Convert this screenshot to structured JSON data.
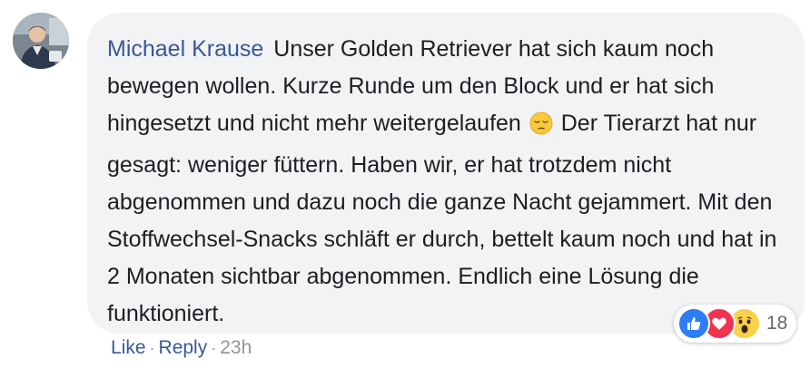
{
  "comment": {
    "author": "Michael Krause",
    "text_part1": "Unser Golden Retriever hat sich kaum noch bewegen wollen. Kurze Runde um den Block und er hat sich hingesetzt und nicht mehr weitergelaufen",
    "emoji": "pensive-face-emoji",
    "text_part2": "Der Tierarzt hat nur gesagt: weniger füttern. Haben wir, er hat trotzdem nicht abgenommen und dazu noch die ganze Nacht gejammert. Mit den Stoffwechsel-Snacks schläft er durch, bettelt kaum noch und hat in 2 Monaten sichtbar abgenommen. Endlich eine Lösung die funktioniert."
  },
  "reactions": {
    "icons": [
      "like-icon",
      "love-icon",
      "wow-icon"
    ],
    "count": "18"
  },
  "actions": {
    "like_label": "Like",
    "reply_label": "Reply",
    "separator": "·",
    "timestamp": "23h"
  },
  "colors": {
    "author": "#385898",
    "bubble": "#f2f3f5",
    "text": "#1c1e21",
    "muted": "#90949c",
    "like": "#2f7df6",
    "love": "#f0344f",
    "wow": "#fbd14b"
  }
}
